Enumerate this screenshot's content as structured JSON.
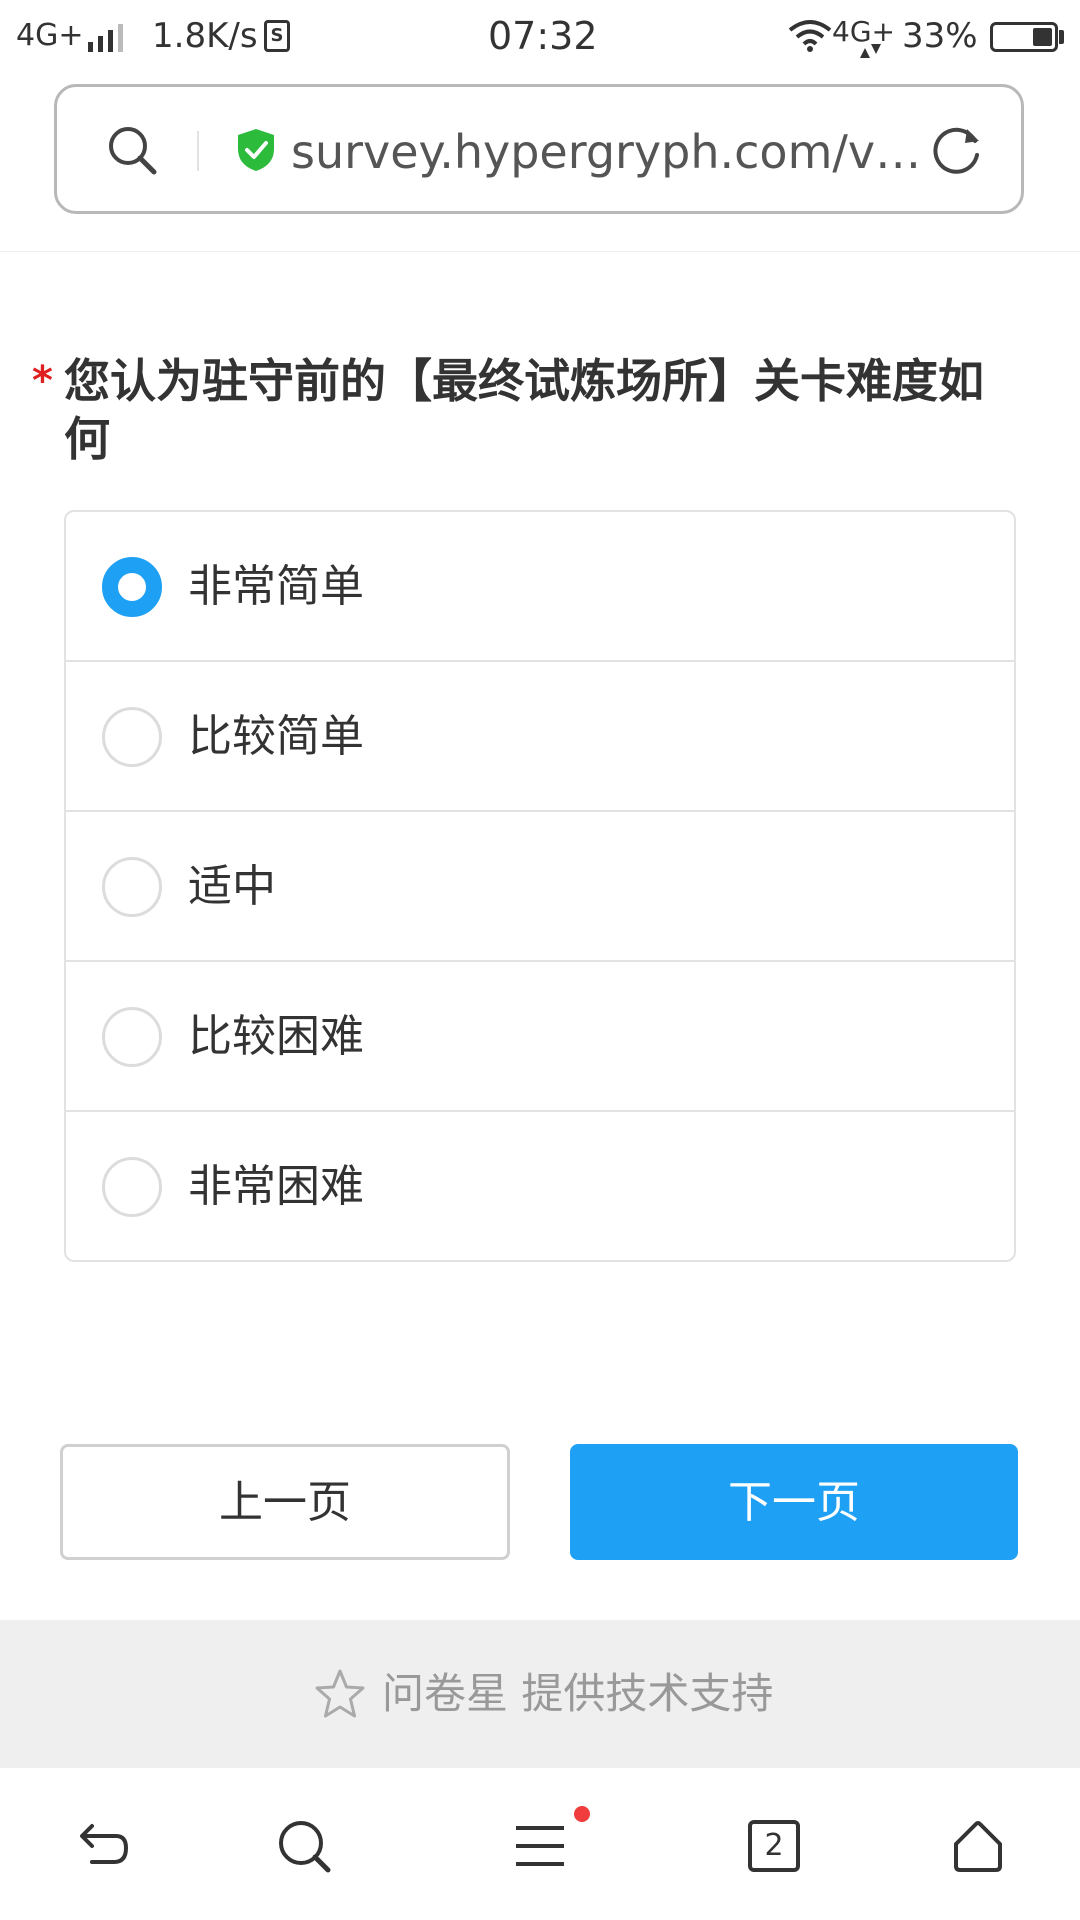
{
  "status_bar": {
    "network": "4G+",
    "speed": "1.8K/s",
    "sim_icon": "S",
    "time": "07:32",
    "network2": "4G+",
    "battery": "33%"
  },
  "address_bar": {
    "url": "survey.hypergryph.com/v…"
  },
  "question": {
    "required_mark": "*",
    "title": "您认为驻守前的【最终试炼场所】关卡难度如何"
  },
  "options": [
    {
      "label": "非常简单",
      "checked": true
    },
    {
      "label": "比较简单",
      "checked": false
    },
    {
      "label": "适中",
      "checked": false
    },
    {
      "label": "比较困难",
      "checked": false
    },
    {
      "label": "非常困难",
      "checked": false
    }
  ],
  "buttons": {
    "prev": "上一页",
    "next": "下一页"
  },
  "footer": {
    "text": "问卷星 提供技术支持"
  },
  "browser_nav": {
    "tab_count": "2"
  },
  "colors": {
    "accent": "#1ea0f5",
    "required": "#e02020",
    "secure": "#2dbb3c",
    "notification_dot": "#f03c3c"
  }
}
